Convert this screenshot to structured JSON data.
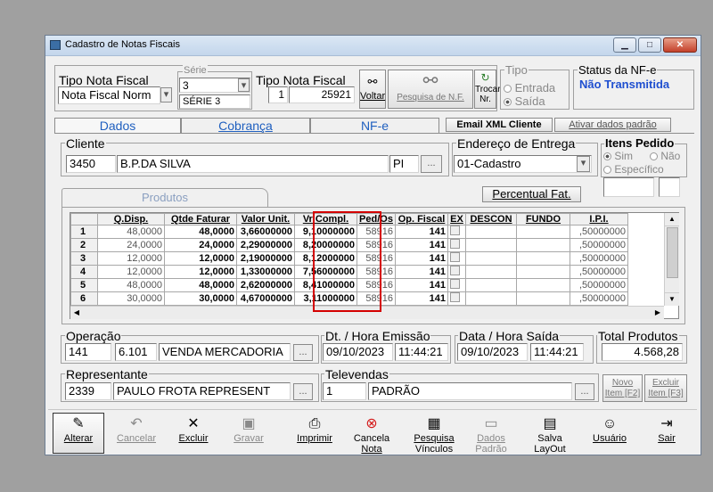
{
  "window": {
    "title": "Cadastro de Notas Fiscais"
  },
  "header": {
    "tipo_nota_label": "Tipo Nota Fiscal",
    "tipo_nota_value": "Nota Fiscal Norm",
    "serie_label": "Série",
    "serie_value": "3",
    "serie_desc": "SÉRIE 3",
    "tipo_nota2_label": "Tipo Nota Fiscal",
    "tipo_nota2_code": "1",
    "tipo_nota2_number": "25921",
    "voltar_label": "Voltar",
    "pesquisa_nf_label": "Pesquisa de N.F.",
    "trocar_nr_label1": "Trocar",
    "trocar_nr_label2": "Nr.",
    "tipo_group_label": "Tipo",
    "entrada_label": "Entrada",
    "saida_label": "Saída",
    "status_label": "Status da NF-e",
    "status_value": "Não Transmitida"
  },
  "tabs": [
    {
      "label": "Dados"
    },
    {
      "label": "Cobrança"
    },
    {
      "label": "NF-e"
    }
  ],
  "top_buttons": {
    "email_xml": "Email XML Cliente",
    "ativar_padrao": "Ativar dados padrão"
  },
  "cliente": {
    "label": "Cliente",
    "code": "3450",
    "name": "B.P.DA SILVA",
    "uf": "PI"
  },
  "endereco": {
    "label": "Endereço de Entrega",
    "value": "01-Cadastro"
  },
  "itens_pedido": {
    "label": "Itens Pedido",
    "sim": "Sim",
    "nao": "Não",
    "especifico": "Específico"
  },
  "produtos": {
    "tab_label": "Produtos",
    "percentual_label": "Percentual Fat.",
    "columns": [
      "Q.Disp.",
      "Qtde Faturar",
      "Valor Unit.",
      "Vr Compl.",
      "Ped/Os",
      "Op. Fiscal",
      "EX",
      "DESCON",
      "FUNDO",
      "I.P.I."
    ],
    "rows": [
      {
        "num": "1",
        "qdisp": "48,0000",
        "qtde": "48,0000",
        "vunit": "3,66000000",
        "vcompl": "9,10000000",
        "pedos": "58916",
        "opf": "141",
        "ipi": ",50000000"
      },
      {
        "num": "2",
        "qdisp": "24,0000",
        "qtde": "24,0000",
        "vunit": "2,29000000",
        "vcompl": "8,20000000",
        "pedos": "58916",
        "opf": "141",
        "ipi": ",50000000"
      },
      {
        "num": "3",
        "qdisp": "12,0000",
        "qtde": "12,0000",
        "vunit": "2,19000000",
        "vcompl": "8,12000000",
        "pedos": "58916",
        "opf": "141",
        "ipi": ",50000000"
      },
      {
        "num": "4",
        "qdisp": "12,0000",
        "qtde": "12,0000",
        "vunit": "1,33000000",
        "vcompl": "7,56000000",
        "pedos": "58916",
        "opf": "141",
        "ipi": ",50000000"
      },
      {
        "num": "5",
        "qdisp": "48,0000",
        "qtde": "48,0000",
        "vunit": "2,62000000",
        "vcompl": "8,41000000",
        "pedos": "58916",
        "opf": "141",
        "ipi": ",50000000"
      },
      {
        "num": "6",
        "qdisp": "30,0000",
        "qtde": "30,0000",
        "vunit": "4,67000000",
        "vcompl": "3,11000000",
        "pedos": "58916",
        "opf": "141",
        "ipi": ",50000000"
      }
    ]
  },
  "operacao": {
    "label": "Operação",
    "code": "141",
    "cfop": "6.101",
    "desc": "VENDA MERCADORIA"
  },
  "emissao": {
    "label": "Dt. / Hora Emissão",
    "date": "09/10/2023",
    "time": "11:44:21"
  },
  "saida": {
    "label": "Data / Hora Saída",
    "date": "09/10/2023",
    "time": "11:44:21"
  },
  "total": {
    "label": "Total Produtos",
    "value": "4.568,28"
  },
  "representante": {
    "label": "Representante",
    "code": "2339",
    "name": "PAULO FROTA REPRESENT"
  },
  "televendas": {
    "label": "Televendas",
    "code": "1",
    "name": "PADRÃO"
  },
  "item_buttons": {
    "novo1": "Novo",
    "novo2": "Item [F2]",
    "excluir1": "Excluir",
    "excluir2": "Item [F3]"
  },
  "toolbar": [
    {
      "l1": "Alterar",
      "l2": ""
    },
    {
      "l1": "Cancelar",
      "l2": ""
    },
    {
      "l1": "Excluir",
      "l2": ""
    },
    {
      "l1": "Gravar",
      "l2": ""
    },
    {
      "l1": "Imprimir",
      "l2": ""
    },
    {
      "l1": "Cancela",
      "l2": "Nota"
    },
    {
      "l1": "Pesquisa",
      "l2": "Vínculos"
    },
    {
      "l1": "Dados",
      "l2": "Padrão"
    },
    {
      "l1": "Salva",
      "l2": "LayOut"
    },
    {
      "l1": "Usuário",
      "l2": ""
    },
    {
      "l1": "Sair",
      "l2": ""
    }
  ],
  "colors": {
    "highlight": "#d40000",
    "accent_blue": "#1f5fbf"
  }
}
